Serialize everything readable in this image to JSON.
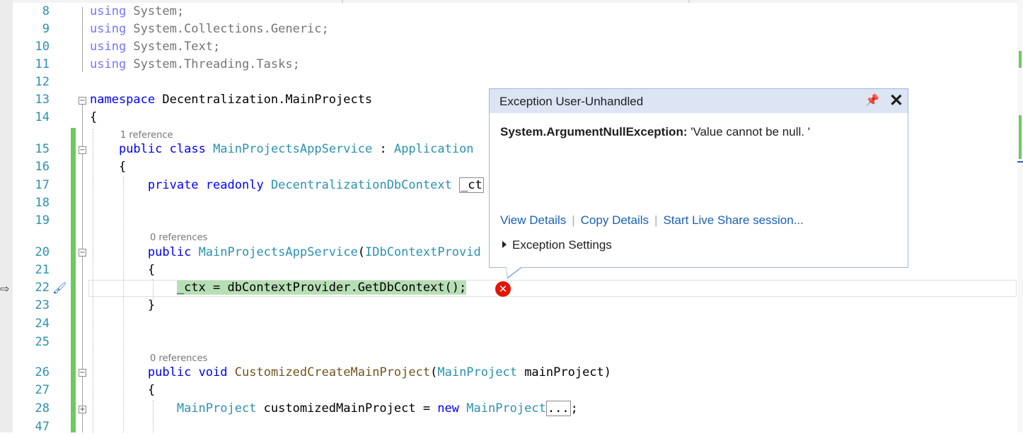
{
  "editor": {
    "lines": [
      {
        "num": "8",
        "tokens": [
          {
            "t": "using",
            "c": "kw dim"
          },
          {
            "t": " System;",
            "c": "dim"
          }
        ]
      },
      {
        "num": "9",
        "tokens": [
          {
            "t": "using",
            "c": "kw dim"
          },
          {
            "t": " System.Collections.Generic;",
            "c": "dim"
          }
        ]
      },
      {
        "num": "10",
        "tokens": [
          {
            "t": "using",
            "c": "kw dim"
          },
          {
            "t": " System.Text;",
            "c": "dim"
          }
        ]
      },
      {
        "num": "11",
        "tokens": [
          {
            "t": "using",
            "c": "kw dim"
          },
          {
            "t": " System.Threading.Tasks;",
            "c": "dim"
          }
        ]
      },
      {
        "num": "12",
        "tokens": []
      },
      {
        "num": "13",
        "tokens": [
          {
            "t": "namespace",
            "c": "kw"
          },
          {
            "t": " Decentralization.MainProjects",
            "c": ""
          }
        ]
      },
      {
        "num": "14",
        "tokens": [
          {
            "t": "{",
            "c": ""
          }
        ]
      },
      {
        "num": "15",
        "tokens": [
          {
            "t": "    ",
            "c": ""
          },
          {
            "t": "public",
            "c": "kw"
          },
          {
            "t": " ",
            "c": ""
          },
          {
            "t": "class",
            "c": "kw"
          },
          {
            "t": " ",
            "c": ""
          },
          {
            "t": "MainProjectsAppService",
            "c": "ty"
          },
          {
            "t": " : ",
            "c": ""
          },
          {
            "t": "Application",
            "c": "ty"
          }
        ]
      },
      {
        "num": "16",
        "tokens": [
          {
            "t": "    {",
            "c": ""
          }
        ]
      },
      {
        "num": "17",
        "tokens": [
          {
            "t": "        ",
            "c": ""
          },
          {
            "t": "private",
            "c": "kw"
          },
          {
            "t": " ",
            "c": ""
          },
          {
            "t": "readonly",
            "c": "kw"
          },
          {
            "t": " ",
            "c": ""
          },
          {
            "t": "DecentralizationDbContext",
            "c": "ty"
          },
          {
            "t": " ",
            "c": ""
          },
          {
            "t": "_ct",
            "c": "ctx-box"
          }
        ]
      },
      {
        "num": "18",
        "tokens": []
      },
      {
        "num": "19",
        "tokens": []
      },
      {
        "num": "20",
        "tokens": [
          {
            "t": "        ",
            "c": ""
          },
          {
            "t": "public",
            "c": "kw"
          },
          {
            "t": " ",
            "c": ""
          },
          {
            "t": "MainProjectsAppService",
            "c": "ty"
          },
          {
            "t": "(",
            "c": ""
          },
          {
            "t": "IDbContextProvid",
            "c": "ty"
          }
        ]
      },
      {
        "num": "21",
        "tokens": [
          {
            "t": "        {",
            "c": ""
          }
        ]
      },
      {
        "num": "22",
        "tokens": [
          {
            "t": "            ",
            "c": ""
          },
          {
            "t": "_ctx = dbContextProvider.GetDbContext();",
            "c": "hl"
          }
        ]
      },
      {
        "num": "23",
        "tokens": [
          {
            "t": "        }",
            "c": ""
          }
        ]
      },
      {
        "num": "24",
        "tokens": []
      },
      {
        "num": "25",
        "tokens": []
      },
      {
        "num": "26",
        "tokens": [
          {
            "t": "        ",
            "c": ""
          },
          {
            "t": "public",
            "c": "kw"
          },
          {
            "t": " ",
            "c": ""
          },
          {
            "t": "void",
            "c": "kw"
          },
          {
            "t": " ",
            "c": ""
          },
          {
            "t": "CustomizedCreateMainProject",
            "c": "fn"
          },
          {
            "t": "(",
            "c": ""
          },
          {
            "t": "MainProject",
            "c": "ty"
          },
          {
            "t": " mainProject)",
            "c": ""
          }
        ]
      },
      {
        "num": "27",
        "tokens": [
          {
            "t": "        {",
            "c": ""
          }
        ]
      },
      {
        "num": "28",
        "tokens": [
          {
            "t": "            ",
            "c": ""
          },
          {
            "t": "MainProject",
            "c": "ty"
          },
          {
            "t": " customizedMainProject = ",
            "c": ""
          },
          {
            "t": "new",
            "c": "kw"
          },
          {
            "t": " ",
            "c": ""
          },
          {
            "t": "MainProject",
            "c": "ty"
          },
          {
            "t": "...",
            "c": "ellipsis-box"
          },
          {
            "t": ";",
            "c": ""
          }
        ]
      },
      {
        "num": "47",
        "tokens": []
      }
    ],
    "codelens": [
      {
        "after_line": "14",
        "text": "1 reference"
      },
      {
        "after_line": "19",
        "text": "0 references"
      },
      {
        "after_line": "25",
        "text": "0 references"
      }
    ]
  },
  "exception_popup": {
    "title": "Exception User-Unhandled",
    "exception_type": "System.ArgumentNullException:",
    "message": " 'Value cannot be null. '",
    "links": [
      "View Details",
      "Copy Details",
      "Start Live Share session..."
    ],
    "settings_label": "Exception Settings",
    "pin_icon": "pin-icon",
    "close_icon": "close-icon"
  },
  "icons": {
    "execution_arrow": "current-statement-arrow-icon",
    "edit_brush": "quick-action-brush-icon",
    "error": "error-x-icon"
  },
  "colors": {
    "keyword": "#0000ff",
    "type": "#2b91af",
    "change_bar": "#6ccb5f",
    "highlight": "#b7dfb5",
    "popup_header": "#dde4f4",
    "link": "#1a5fb4",
    "error": "#e51400"
  }
}
